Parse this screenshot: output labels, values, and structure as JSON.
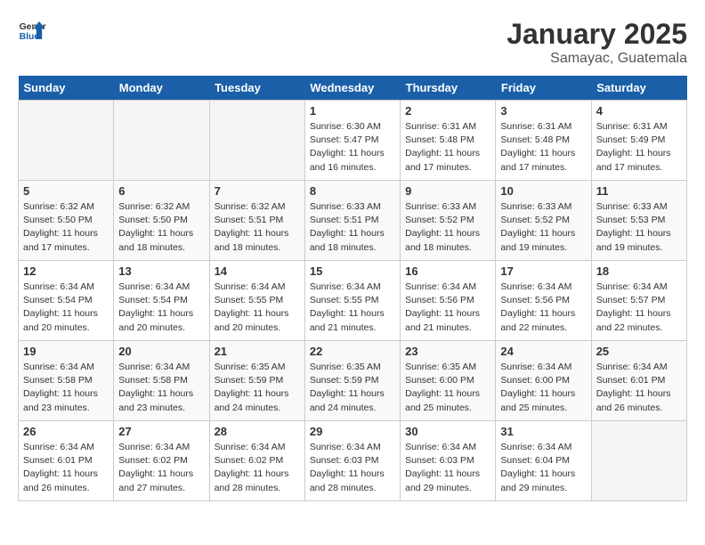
{
  "header": {
    "logo_line1": "General",
    "logo_line2": "Blue",
    "month": "January 2025",
    "location": "Samayac, Guatemala"
  },
  "days_of_week": [
    "Sunday",
    "Monday",
    "Tuesday",
    "Wednesday",
    "Thursday",
    "Friday",
    "Saturday"
  ],
  "weeks": [
    [
      {
        "day": "",
        "info": ""
      },
      {
        "day": "",
        "info": ""
      },
      {
        "day": "",
        "info": ""
      },
      {
        "day": "1",
        "info": "Sunrise: 6:30 AM\nSunset: 5:47 PM\nDaylight: 11 hours\nand 16 minutes."
      },
      {
        "day": "2",
        "info": "Sunrise: 6:31 AM\nSunset: 5:48 PM\nDaylight: 11 hours\nand 17 minutes."
      },
      {
        "day": "3",
        "info": "Sunrise: 6:31 AM\nSunset: 5:48 PM\nDaylight: 11 hours\nand 17 minutes."
      },
      {
        "day": "4",
        "info": "Sunrise: 6:31 AM\nSunset: 5:49 PM\nDaylight: 11 hours\nand 17 minutes."
      }
    ],
    [
      {
        "day": "5",
        "info": "Sunrise: 6:32 AM\nSunset: 5:50 PM\nDaylight: 11 hours\nand 17 minutes."
      },
      {
        "day": "6",
        "info": "Sunrise: 6:32 AM\nSunset: 5:50 PM\nDaylight: 11 hours\nand 18 minutes."
      },
      {
        "day": "7",
        "info": "Sunrise: 6:32 AM\nSunset: 5:51 PM\nDaylight: 11 hours\nand 18 minutes."
      },
      {
        "day": "8",
        "info": "Sunrise: 6:33 AM\nSunset: 5:51 PM\nDaylight: 11 hours\nand 18 minutes."
      },
      {
        "day": "9",
        "info": "Sunrise: 6:33 AM\nSunset: 5:52 PM\nDaylight: 11 hours\nand 18 minutes."
      },
      {
        "day": "10",
        "info": "Sunrise: 6:33 AM\nSunset: 5:52 PM\nDaylight: 11 hours\nand 19 minutes."
      },
      {
        "day": "11",
        "info": "Sunrise: 6:33 AM\nSunset: 5:53 PM\nDaylight: 11 hours\nand 19 minutes."
      }
    ],
    [
      {
        "day": "12",
        "info": "Sunrise: 6:34 AM\nSunset: 5:54 PM\nDaylight: 11 hours\nand 20 minutes."
      },
      {
        "day": "13",
        "info": "Sunrise: 6:34 AM\nSunset: 5:54 PM\nDaylight: 11 hours\nand 20 minutes."
      },
      {
        "day": "14",
        "info": "Sunrise: 6:34 AM\nSunset: 5:55 PM\nDaylight: 11 hours\nand 20 minutes."
      },
      {
        "day": "15",
        "info": "Sunrise: 6:34 AM\nSunset: 5:55 PM\nDaylight: 11 hours\nand 21 minutes."
      },
      {
        "day": "16",
        "info": "Sunrise: 6:34 AM\nSunset: 5:56 PM\nDaylight: 11 hours\nand 21 minutes."
      },
      {
        "day": "17",
        "info": "Sunrise: 6:34 AM\nSunset: 5:56 PM\nDaylight: 11 hours\nand 22 minutes."
      },
      {
        "day": "18",
        "info": "Sunrise: 6:34 AM\nSunset: 5:57 PM\nDaylight: 11 hours\nand 22 minutes."
      }
    ],
    [
      {
        "day": "19",
        "info": "Sunrise: 6:34 AM\nSunset: 5:58 PM\nDaylight: 11 hours\nand 23 minutes."
      },
      {
        "day": "20",
        "info": "Sunrise: 6:34 AM\nSunset: 5:58 PM\nDaylight: 11 hours\nand 23 minutes."
      },
      {
        "day": "21",
        "info": "Sunrise: 6:35 AM\nSunset: 5:59 PM\nDaylight: 11 hours\nand 24 minutes."
      },
      {
        "day": "22",
        "info": "Sunrise: 6:35 AM\nSunset: 5:59 PM\nDaylight: 11 hours\nand 24 minutes."
      },
      {
        "day": "23",
        "info": "Sunrise: 6:35 AM\nSunset: 6:00 PM\nDaylight: 11 hours\nand 25 minutes."
      },
      {
        "day": "24",
        "info": "Sunrise: 6:34 AM\nSunset: 6:00 PM\nDaylight: 11 hours\nand 25 minutes."
      },
      {
        "day": "25",
        "info": "Sunrise: 6:34 AM\nSunset: 6:01 PM\nDaylight: 11 hours\nand 26 minutes."
      }
    ],
    [
      {
        "day": "26",
        "info": "Sunrise: 6:34 AM\nSunset: 6:01 PM\nDaylight: 11 hours\nand 26 minutes."
      },
      {
        "day": "27",
        "info": "Sunrise: 6:34 AM\nSunset: 6:02 PM\nDaylight: 11 hours\nand 27 minutes."
      },
      {
        "day": "28",
        "info": "Sunrise: 6:34 AM\nSunset: 6:02 PM\nDaylight: 11 hours\nand 28 minutes."
      },
      {
        "day": "29",
        "info": "Sunrise: 6:34 AM\nSunset: 6:03 PM\nDaylight: 11 hours\nand 28 minutes."
      },
      {
        "day": "30",
        "info": "Sunrise: 6:34 AM\nSunset: 6:03 PM\nDaylight: 11 hours\nand 29 minutes."
      },
      {
        "day": "31",
        "info": "Sunrise: 6:34 AM\nSunset: 6:04 PM\nDaylight: 11 hours\nand 29 minutes."
      },
      {
        "day": "",
        "info": ""
      }
    ]
  ]
}
